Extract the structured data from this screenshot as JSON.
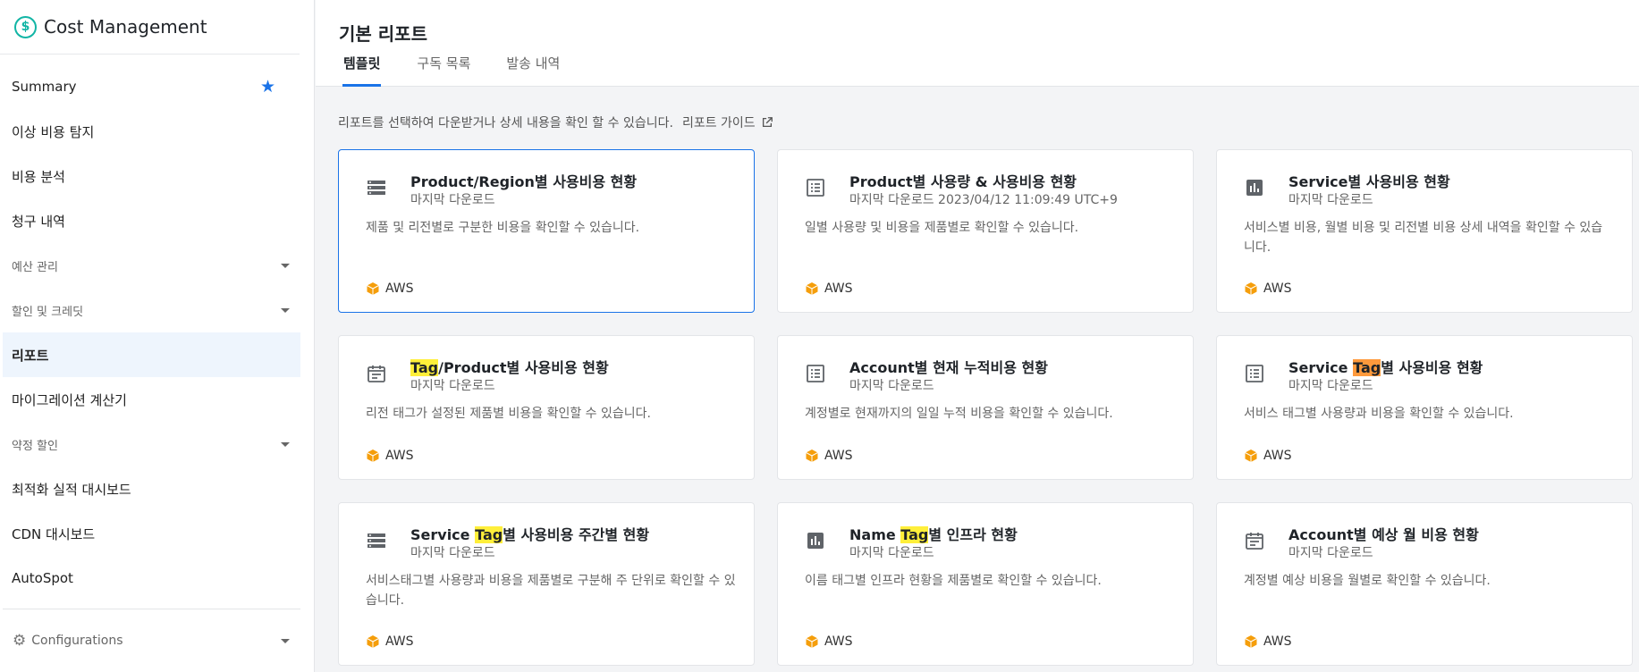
{
  "app": {
    "title": "Cost Management"
  },
  "sidebar": {
    "items": [
      {
        "label": "Summary",
        "starred": true
      },
      {
        "label": "이상 비용 탐지"
      },
      {
        "label": "비용 분석"
      },
      {
        "label": "청구 내역"
      },
      {
        "label": "예산 관리",
        "group": true
      },
      {
        "label": "할인 및 크레딧",
        "group": true
      },
      {
        "label": "리포트",
        "active": true
      },
      {
        "label": "마이그레이션 계산기"
      },
      {
        "label": "약정 할인",
        "group": true
      },
      {
        "label": "최적화 실적 대시보드"
      },
      {
        "label": "CDN 대시보드"
      },
      {
        "label": "AutoSpot"
      }
    ],
    "config_label": "Configurations"
  },
  "header": {
    "title": "기본 리포트",
    "tabs": [
      {
        "label": "템플릿",
        "active": true
      },
      {
        "label": "구독 목록"
      },
      {
        "label": "발송 내역"
      }
    ]
  },
  "intro": {
    "text": "리포트를 선택하여 다운받거나 상세 내용을 확인 할 수 있습니다.",
    "guide_label": "리포트 가이드"
  },
  "cards": [
    {
      "icon": "list-rows-icon",
      "title_pre": "",
      "title_hl": "",
      "title_post": "Product/Region별 사용비용 현황",
      "sub": "마지막 다운로드",
      "desc": "제품 및 리전별로 구분한 비용을 확인할 수 있습니다.",
      "vendor": "AWS"
    },
    {
      "icon": "list-detail-icon",
      "title_pre": "",
      "title_hl": "",
      "title_post": "Product별 사용량 & 사용비용 현황",
      "sub": "마지막 다운로드 2023/04/12 11:09:49 UTC+9",
      "desc": "일별 사용량 및 비용을 제품별로 확인할 수 있습니다.",
      "vendor": "AWS"
    },
    {
      "icon": "bar-chart-icon",
      "title_pre": "",
      "title_hl": "",
      "title_post": "Service별 사용비용 현황",
      "sub": "마지막 다운로드",
      "desc": "서비스별 비용, 월별 비용 및 리전별 비용 상세 내역을 확인할 수 있습니다.",
      "vendor": "AWS"
    },
    {
      "icon": "calendar-icon",
      "title_pre": "",
      "title_hl": "Tag",
      "title_post": "/Product별 사용비용 현황",
      "sub": "마지막 다운로드",
      "desc": "리전 태그가 설정된 제품별 비용을 확인할 수 있습니다.",
      "vendor": "AWS"
    },
    {
      "icon": "list-detail-icon",
      "title_pre": "",
      "title_hl": "",
      "title_post": "Account별 현재 누적비용 현황",
      "sub": "마지막 다운로드",
      "desc": "계정별로 현재까지의 일일 누적 비용을 확인할 수 있습니다.",
      "vendor": "AWS"
    },
    {
      "icon": "list-detail-icon",
      "title_pre": "Service ",
      "title_hl": "Tag",
      "title_post": "별 사용비용 현황",
      "sub": "마지막 다운로드",
      "desc": "서비스 태그별 사용량과 비용을 확인할 수 있습니다.",
      "vendor": "AWS",
      "hl_orange": true
    },
    {
      "icon": "list-rows-icon",
      "title_pre": "Service ",
      "title_hl": "Tag",
      "title_post": "별 사용비용 주간별 현황",
      "sub": "마지막 다운로드",
      "desc": "서비스태그별 사용량과 비용을 제품별로 구분해 주 단위로 확인할 수 있습니다.",
      "vendor": "AWS"
    },
    {
      "icon": "bar-chart-icon",
      "title_pre": "Name ",
      "title_hl": "Tag",
      "title_post": "별 인프라 현황",
      "sub": "마지막 다운로드",
      "desc": "이름 태그별 인프라 현황을 제품별로 확인할 수 있습니다.",
      "vendor": "AWS"
    },
    {
      "icon": "calendar-icon",
      "title_pre": "",
      "title_hl": "",
      "title_post": "Account별 예상 월 비용 현황",
      "sub": "마지막 다운로드",
      "desc": "계정별 예상 비용을 월별로 확인할 수 있습니다.",
      "vendor": "AWS"
    }
  ],
  "colors": {
    "accent": "#1a73e8",
    "brand": "#12b5a5",
    "highlight": "#ffef3a",
    "highlight_active": "#ff9a3c",
    "aws": "#f59e0b"
  }
}
